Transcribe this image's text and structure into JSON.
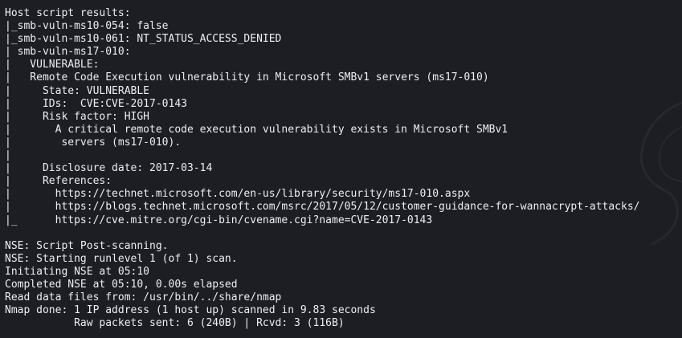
{
  "terminal": {
    "lines": [
      "Host script results:",
      "|_smb-vuln-ms10-054: false",
      "|_smb-vuln-ms10-061: NT_STATUS_ACCESS_DENIED",
      "| smb-vuln-ms17-010:",
      "|   VULNERABLE:",
      "|   Remote Code Execution vulnerability in Microsoft SMBv1 servers (ms17-010)",
      "|     State: VULNERABLE",
      "|     IDs:  CVE:CVE-2017-0143",
      "|     Risk factor: HIGH",
      "|       A critical remote code execution vulnerability exists in Microsoft SMBv1",
      "|        servers (ms17-010).",
      "|",
      "|     Disclosure date: 2017-03-14",
      "|     References:",
      "|       https://technet.microsoft.com/en-us/library/security/ms17-010.aspx",
      "|       https://blogs.technet.microsoft.com/msrc/2017/05/12/customer-guidance-for-wannacrypt-attacks/",
      "|_      https://cve.mitre.org/cgi-bin/cvename.cgi?name=CVE-2017-0143",
      "",
      "NSE: Script Post-scanning.",
      "NSE: Starting runlevel 1 (of 1) scan.",
      "Initiating NSE at 05:10",
      "Completed NSE at 05:10, 0.00s elapsed",
      "Read data files from: /usr/bin/../share/nmap",
      "Nmap done: 1 IP address (1 host up) scanned in 9.83 seconds",
      "           Raw packets sent: 6 (240B) | Rcvd: 3 (116B)"
    ]
  },
  "colors": {
    "background": "#1c1e24",
    "foreground": "#eceff1"
  },
  "icons": {
    "watermark": "kali-dragon-icon"
  }
}
